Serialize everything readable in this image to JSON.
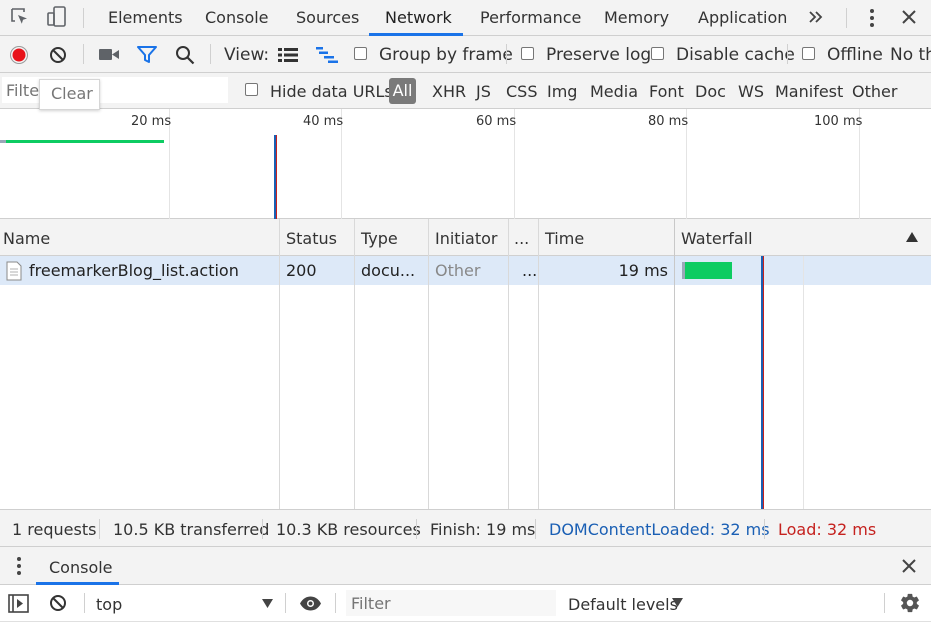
{
  "tabs": [
    {
      "label": "Elements"
    },
    {
      "label": "Console"
    },
    {
      "label": "Sources"
    },
    {
      "label": "Network"
    },
    {
      "label": "Performance"
    },
    {
      "label": "Memory"
    },
    {
      "label": "Application"
    }
  ],
  "active_tab": "Network",
  "toolbar": {
    "view_label": "View:",
    "group_by_frame": "Group by frame",
    "preserve_log": "Preserve log",
    "disable_cache": "Disable cache",
    "offline": "Offline",
    "throttling": "No th"
  },
  "filter": {
    "placeholder": "Filter",
    "clear_tooltip": "Clear",
    "hide_data_urls": "Hide data URLs",
    "types": [
      "All",
      "XHR",
      "JS",
      "CSS",
      "Img",
      "Media",
      "Font",
      "Doc",
      "WS",
      "Manifest",
      "Other"
    ]
  },
  "overview": {
    "ticks": [
      "20 ms",
      "40 ms",
      "60 ms",
      "80 ms",
      "100 ms"
    ]
  },
  "table": {
    "columns": [
      "Name",
      "Status",
      "Type",
      "Initiator",
      "...",
      "Time",
      "Waterfall"
    ],
    "rows": [
      {
        "name": "freemarkerBlog_list.action",
        "status": "200",
        "type": "docu...",
        "initiator": "Other",
        "size": "...",
        "time": "19 ms"
      }
    ]
  },
  "status": {
    "requests": "1 requests",
    "transferred": "10.5 KB transferred",
    "resources": "10.3 KB resources",
    "finish": "Finish: 19 ms",
    "dom_content_loaded": "DOMContentLoaded: 32 ms",
    "load": "Load: 32 ms"
  },
  "drawer": {
    "tab": "Console",
    "context": "top",
    "filter_placeholder": "Filter",
    "levels": "Default levels"
  },
  "colors": {
    "accent": "#1a73e8",
    "dom_content_loaded": "#1a5fb4",
    "load": "#c5221f",
    "waterfall_bar": "#0dcc62",
    "record": "#e8131a",
    "selected_row": "#dde9f8"
  }
}
